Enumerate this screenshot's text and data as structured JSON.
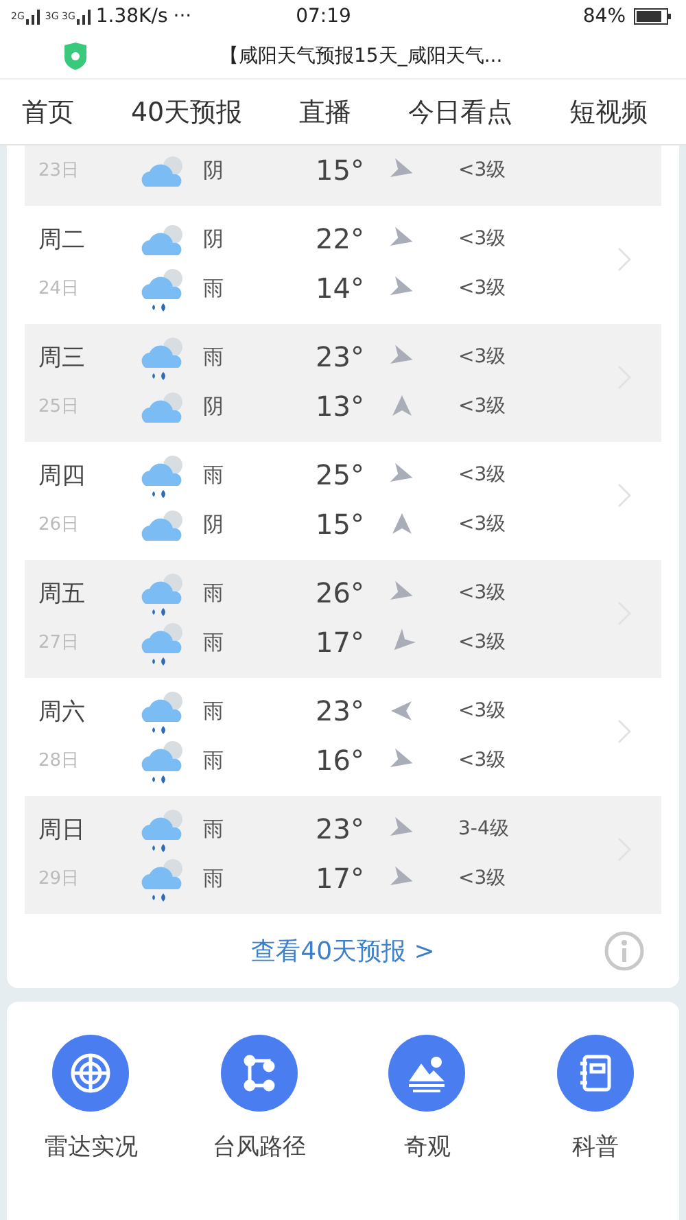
{
  "status_bar": {
    "network": "2G",
    "network2": "3G 3G",
    "speed": "1.38K/s",
    "more": "···",
    "time": "07:19",
    "battery": "84%"
  },
  "browser": {
    "title": "【咸阳天气预报15天_咸阳天气..."
  },
  "nav": [
    "首页",
    "40天预报",
    "直播",
    "今日看点",
    "短视频"
  ],
  "days": [
    {
      "date": "23日",
      "night": {
        "kind": "cloudy",
        "condition": "阴",
        "temp": "15°",
        "arrow": {
          "kind": "se"
        },
        "wind": "<3级"
      }
    },
    {
      "weekday": "周二",
      "date": "24日",
      "day": {
        "kind": "cloudy",
        "condition": "阴",
        "temp": "22°",
        "arrow": {
          "kind": "se"
        },
        "wind": "<3级"
      },
      "night": {
        "kind": "rain",
        "condition": "雨",
        "temp": "14°",
        "arrow": {
          "kind": "se"
        },
        "wind": "<3级"
      }
    },
    {
      "weekday": "周三",
      "date": "25日",
      "day": {
        "kind": "rain",
        "condition": "雨",
        "temp": "23°",
        "arrow": {
          "kind": "se"
        },
        "wind": "<3级"
      },
      "night": {
        "kind": "cloudy",
        "condition": "阴",
        "temp": "13°",
        "arrow": {
          "kind": "n"
        },
        "wind": "<3级"
      }
    },
    {
      "weekday": "周四",
      "date": "26日",
      "day": {
        "kind": "rain",
        "condition": "雨",
        "temp": "25°",
        "arrow": {
          "kind": "se"
        },
        "wind": "<3级"
      },
      "night": {
        "kind": "cloudy",
        "condition": "阴",
        "temp": "15°",
        "arrow": {
          "kind": "n"
        },
        "wind": "<3级"
      }
    },
    {
      "weekday": "周五",
      "date": "27日",
      "day": {
        "kind": "rain",
        "condition": "雨",
        "temp": "26°",
        "arrow": {
          "kind": "se"
        },
        "wind": "<3级"
      },
      "night": {
        "kind": "rain",
        "condition": "雨",
        "temp": "17°",
        "arrow": {
          "kind": "sw"
        },
        "wind": "<3级"
      }
    },
    {
      "weekday": "周六",
      "date": "28日",
      "day": {
        "kind": "rain",
        "condition": "雨",
        "temp": "23°",
        "arrow": {
          "kind": "w"
        },
        "wind": "<3级"
      },
      "night": {
        "kind": "rain",
        "condition": "雨",
        "temp": "16°",
        "arrow": {
          "kind": "se"
        },
        "wind": "<3级"
      }
    },
    {
      "weekday": "周日",
      "date": "29日",
      "day": {
        "kind": "rain",
        "condition": "雨",
        "temp": "23°",
        "arrow": {
          "kind": "se"
        },
        "wind": "3-4级"
      },
      "night": {
        "kind": "rain",
        "condition": "雨",
        "temp": "17°",
        "arrow": {
          "kind": "se"
        },
        "wind": "<3级"
      }
    }
  ],
  "more_link": "查看40天预报 >",
  "tools": [
    {
      "kind": "radar",
      "label": "雷达实况"
    },
    {
      "kind": "typhoon",
      "label": "台风路径"
    },
    {
      "kind": "scenery",
      "label": "奇观"
    },
    {
      "kind": "science",
      "label": "科普"
    }
  ]
}
